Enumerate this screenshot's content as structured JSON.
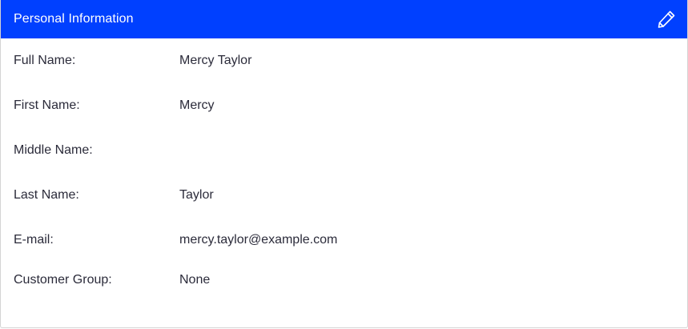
{
  "card": {
    "title": "Personal Information",
    "edit_icon": "pencil-icon",
    "header_color": "#0040ff"
  },
  "fields": [
    {
      "label": "Full Name:",
      "value": "Mercy Taylor"
    },
    {
      "label": "First Name:",
      "value": "Mercy"
    },
    {
      "label": "Middle Name:",
      "value": ""
    },
    {
      "label": "Last Name:",
      "value": "Taylor"
    },
    {
      "label": "E-mail:",
      "value": "mercy.taylor@example.com"
    },
    {
      "label": "Customer Group:",
      "value": "None"
    }
  ]
}
